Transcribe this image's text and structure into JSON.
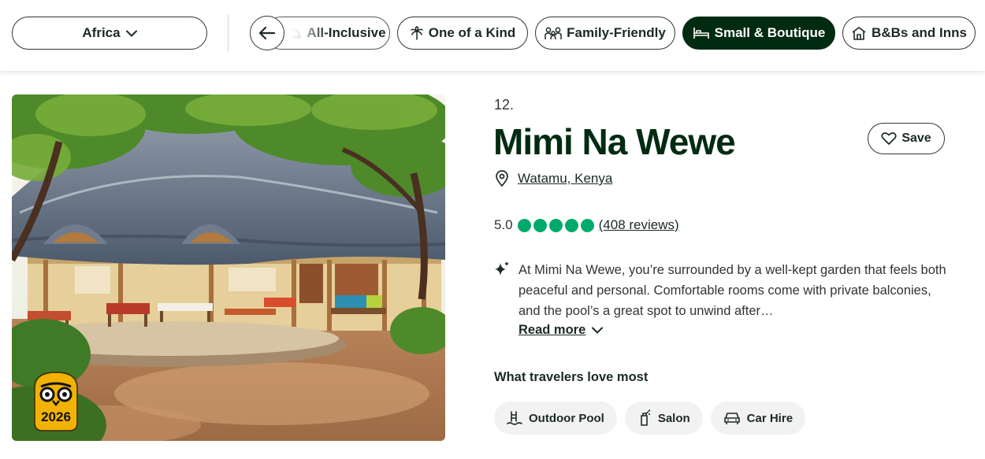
{
  "filters": {
    "region": "Africa",
    "chips": [
      {
        "label": "All-Inclusive",
        "icon": "cloche-icon",
        "active": false
      },
      {
        "label": "One of a Kind",
        "icon": "palm-tree-icon",
        "active": false
      },
      {
        "label": "Family-Friendly",
        "icon": "family-icon",
        "active": false
      },
      {
        "label": "Small & Boutique",
        "icon": "bed-icon",
        "active": true
      },
      {
        "label": "B&Bs and Inns",
        "icon": "house-icon",
        "active": false
      }
    ]
  },
  "hotel": {
    "rank": "12.",
    "name": "Mimi Na Wewe",
    "location": "Watamu, Kenya",
    "rating": "5.0",
    "bubbles": 5,
    "reviews": "(408 reviews)",
    "summary": "At Mimi Na Wewe, you’re surrounded by a well-kept garden that feels both peaceful and personal. Comfortable rooms come with private balconies, and the pool’s a great spot to unwind after…",
    "read_more": "Read more",
    "save_label": "Save",
    "award_year": "2026",
    "loved_heading": "What travelers love most",
    "amenities": [
      {
        "label": "Outdoor Pool",
        "icon": "pool-icon"
      },
      {
        "label": "Salon",
        "icon": "spray-bottle-icon"
      },
      {
        "label": "Car Hire",
        "icon": "car-icon"
      }
    ]
  },
  "colors": {
    "brand_dark": "#002b11",
    "rating_green": "#00aa6c",
    "award_gold": "#f2b203"
  }
}
